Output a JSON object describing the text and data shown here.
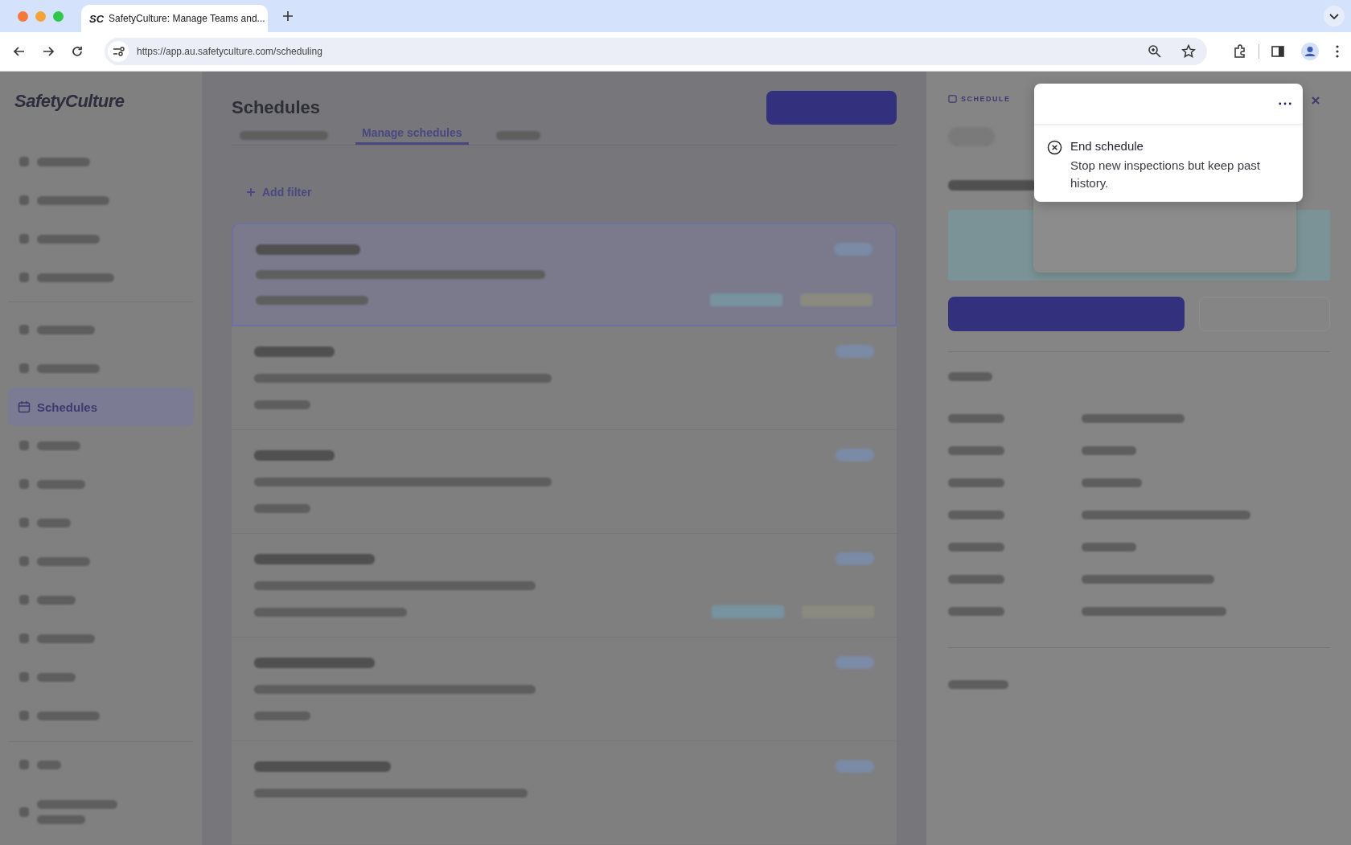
{
  "browser": {
    "tab_logo": "SC",
    "tab_title": "SafetyCulture: Manage Teams and...",
    "url": "https://app.au.safetyculture.com/scheduling"
  },
  "sidebar": {
    "logo": "SafetyCulture",
    "items": [
      {
        "label": "Schedules",
        "selected": true
      }
    ]
  },
  "main": {
    "title": "Schedules",
    "tabs": [
      {
        "label": "Manage schedules",
        "selected": true
      }
    ],
    "add_filter": "Add filter"
  },
  "panel": {
    "label": "SCHEDULE"
  },
  "menu": {
    "items": [
      {
        "label": "End schedule",
        "description": "Stop new inspections but keep past history."
      }
    ]
  }
}
